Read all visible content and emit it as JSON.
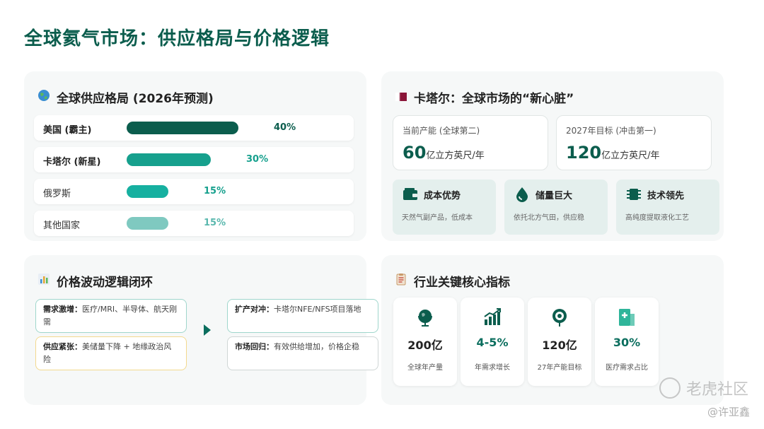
{
  "page": {
    "title": "全球氦气市场：供应格局与价格逻辑"
  },
  "supply": {
    "icon": "globe-icon",
    "title": "全球供应格局 (2026年预测)",
    "rows": [
      {
        "label": "美国 (霸主)",
        "value": 40,
        "pct": "40%",
        "color": "#0b5d4d",
        "pct_color": "#0b5d4d"
      },
      {
        "label": "卡塔尔 (新星)",
        "value": 30,
        "pct": "30%",
        "color": "#16a08d",
        "pct_color": "#16a08d"
      },
      {
        "label": "俄罗斯",
        "value": 15,
        "pct": "15%",
        "color": "#16b0a0",
        "pct_color": "#16a08d"
      },
      {
        "label": "其他国家",
        "value": 15,
        "pct": "15%",
        "color": "#7fc9c0",
        "pct_color": "#5ab8ae"
      }
    ]
  },
  "qatar": {
    "icon": "qatar-flag-icon",
    "title": "卡塔尔：全球市场的“新心脏”",
    "stats": [
      {
        "label": "当前产能 (全球第二)",
        "value": "60",
        "unit": "亿立方英尺/年"
      },
      {
        "label": "2027年目标 (冲击第一)",
        "value": "120",
        "unit": "亿立方英尺/年"
      }
    ],
    "advantages": [
      {
        "icon": "wallet-icon",
        "title": "成本优势",
        "desc": "天然气副产品，低成本"
      },
      {
        "icon": "drop-icon",
        "title": "储量巨大",
        "desc": "依托北方气田，供应稳"
      },
      {
        "icon": "chip-icon",
        "title": "技术领先",
        "desc": "高纯度提取液化工艺"
      }
    ]
  },
  "price": {
    "icon": "bar-chart-icon",
    "title": "价格波动逻辑闭环",
    "items": [
      {
        "head": "需求激增：",
        "text": "医疗/MRI、半导体、航天刚需",
        "border": "#9fd6cc"
      },
      {
        "head": "供应紧张：",
        "text": "美储量下降 + 地缘政治风险",
        "border": "#f3d98e"
      },
      {
        "head": "扩产对冲：",
        "text": "卡塔尔NFE/NFS项目落地",
        "border": "#9fd6cc"
      },
      {
        "head": "市场回归：",
        "text": "有效供给增加，价格企稳",
        "border": "#cfd6d5"
      }
    ]
  },
  "indicators": {
    "icon": "clipboard-icon",
    "title": "行业关键核心指标",
    "items": [
      {
        "icon": "globe-stand-icon",
        "value": "200亿",
        "label": "全球年产量",
        "teal": false
      },
      {
        "icon": "growth-chart-icon",
        "value": "4-5%",
        "label": "年需求增长",
        "teal": true
      },
      {
        "icon": "target-icon",
        "value": "120亿",
        "label": "27年产能目标",
        "teal": false
      },
      {
        "icon": "medical-icon",
        "value": "30%",
        "label": "医疗需求占比",
        "teal": true
      }
    ]
  },
  "watermark": {
    "text": "老虎社区",
    "author": "@许亚鑫"
  },
  "colors": {
    "primary": "#0b5d4d",
    "accent": "#16a08d",
    "card_bg": "#f6f8f8"
  }
}
